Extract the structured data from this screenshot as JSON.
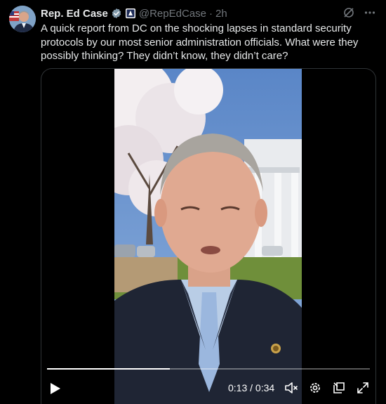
{
  "tweet": {
    "display_name": "Rep. Ed Case",
    "handle": "@RepEdCase",
    "separator": "·",
    "time": "2h",
    "text": "A quick report from DC on the shocking lapses in standard security protocols by our most senior administration officials. What were they possibly thinking? They didn’t know, they didn’t care?",
    "verified_color": "#829aab"
  },
  "video": {
    "time_readout": "0:13 / 0:34",
    "progress": 0.38
  },
  "icons": [
    "grok-icon",
    "more-icon",
    "verified-icon",
    "government-badge-icon",
    "play-icon",
    "mute-icon",
    "settings-icon",
    "pip-icon",
    "fullscreen-icon"
  ]
}
